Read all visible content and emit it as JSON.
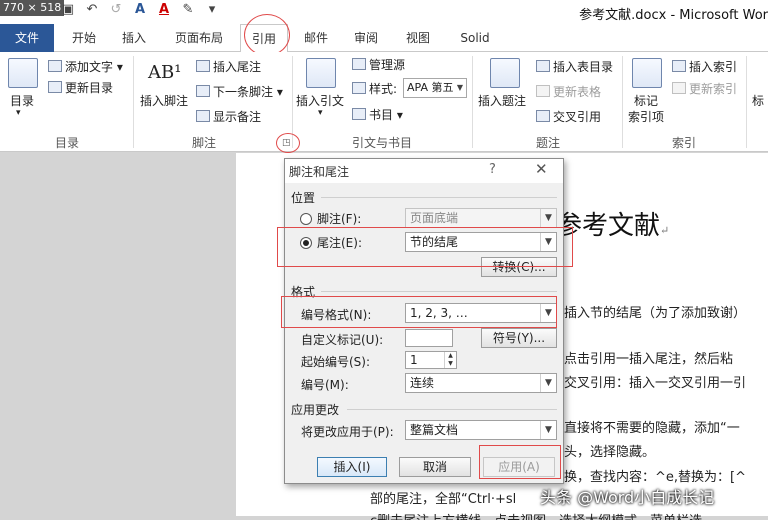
{
  "dim_badge": "770 × 518",
  "window_title": "参考文献.docx - Microsoft Wor",
  "qat": {
    "save": "▣",
    "undo": "↶",
    "redo": "↺",
    "font_a": "A",
    "font_color": "A",
    "brush": "✎",
    "more": "▾"
  },
  "tabs": [
    "文件",
    "开始",
    "插入",
    "页面布局",
    "引用",
    "邮件",
    "审阅",
    "视图",
    "Solid"
  ],
  "ribbon": {
    "toc": {
      "big": "目录",
      "add_text": "添加文字 ▾",
      "update": "更新目录",
      "group": "目录"
    },
    "footnote": {
      "big": "插入脚注",
      "big_icon": "AB¹",
      "insert_endnote": "插入尾注",
      "next_footnote": "下一条脚注 ▾",
      "show_notes": "显示备注",
      "group": "脚注"
    },
    "citation": {
      "big": "插入引文",
      "manage": "管理源",
      "style_label": "样式:",
      "style_value": "APA 第五",
      "bibliography": "书目 ▾",
      "group": "引文与书目"
    },
    "caption": {
      "big": "插入题注",
      "insert_table": "插入表目录",
      "update_table": "更新表格",
      "cross_ref": "交叉引用",
      "group": "题注"
    },
    "index": {
      "mark": "标记",
      "mark2": "索引项",
      "insert_index": "插入索引",
      "update_index": "更新索引",
      "group": "索引",
      "extra": "标"
    }
  },
  "document": {
    "title": "参考文献",
    "lines": [
      "插入节的结尾（为了添加致谢）",
      "点击引用一插入尾注，然后粘",
      "交叉引用：插入一交叉引用一引",
      "直接将不需要的隐藏，添加“一",
      "头，选择隐藏。",
      "换，查找内容：^e,替换为：[^",
      "部的尾注，全部“Ctrl·+sl",
      "c删去尾注上方横线，点击视图，选择大纲模式，菜单栏选"
    ],
    "para_mark": "↵"
  },
  "watermark": "头条 @Word小白成长记",
  "dialog": {
    "title": "脚注和尾注",
    "help": "?",
    "close": "✕",
    "location_section": "位置",
    "footnote_label": "脚注(F):",
    "footnote_value": "页面底端",
    "endnote_label": "尾注(E):",
    "endnote_value": "节的结尾",
    "convert_btn": "转换(C)...",
    "format_section": "格式",
    "number_format_label": "编号格式(N):",
    "number_format_value": "1, 2, 3, …",
    "custom_mark_label": "自定义标记(U):",
    "custom_mark_value": "",
    "symbol_btn": "符号(Y)...",
    "start_at_label": "起始编号(S):",
    "start_at_value": "1",
    "numbering_label": "编号(M):",
    "numbering_value": "连续",
    "apply_section": "应用更改",
    "apply_to_label": "将更改应用于(P):",
    "apply_to_value": "整篇文档",
    "insert_btn": "插入(I)",
    "cancel_btn": "取消",
    "apply_btn": "应用(A)"
  }
}
